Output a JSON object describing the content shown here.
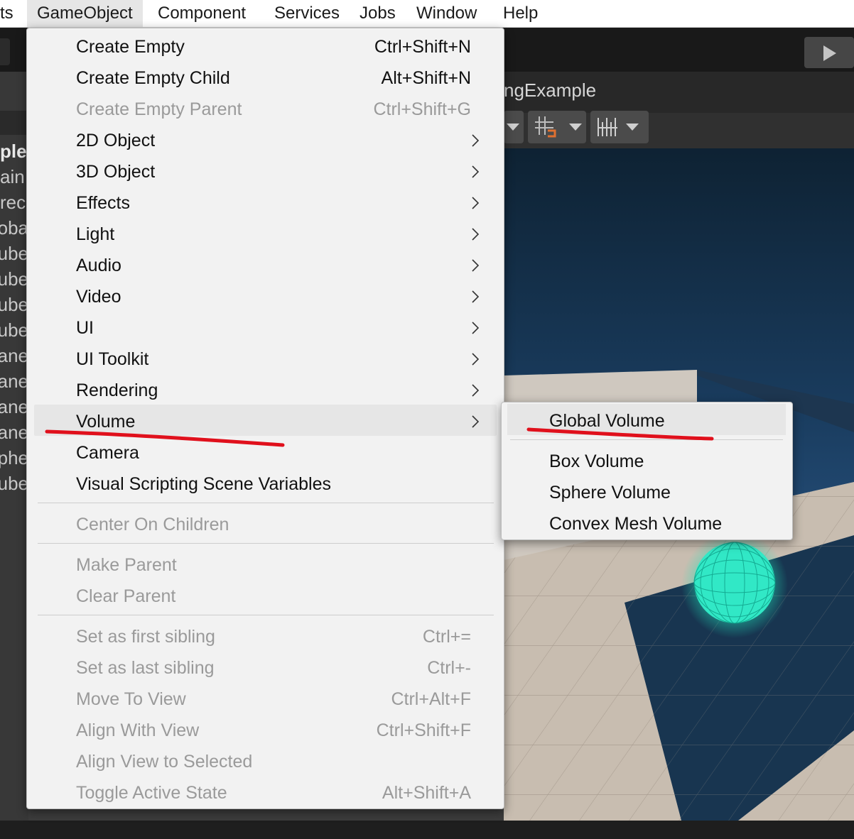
{
  "menubar": {
    "items": [
      "ts",
      "GameObject",
      "Component",
      "Services",
      "Jobs",
      "Window",
      "Help"
    ],
    "active": "GameObject"
  },
  "hierarchy": {
    "items": [
      "ple",
      "ain",
      "rec",
      "oba",
      "ube",
      "ube",
      "ube",
      "ube",
      "ane",
      "ane",
      "ane",
      "ane",
      "phe",
      "ube"
    ]
  },
  "scene": {
    "title": "ngExample"
  },
  "gameobject_menu": {
    "items": [
      {
        "label": "Create Empty",
        "shortcut": "Ctrl+Shift+N"
      },
      {
        "label": "Create Empty Child",
        "shortcut": "Alt+Shift+N"
      },
      {
        "label": "Create Empty Parent",
        "shortcut": "Ctrl+Shift+G"
      },
      {
        "label": "2D Object"
      },
      {
        "label": "3D Object"
      },
      {
        "label": "Effects"
      },
      {
        "label": "Light"
      },
      {
        "label": "Audio"
      },
      {
        "label": "Video"
      },
      {
        "label": "UI"
      },
      {
        "label": "UI Toolkit"
      },
      {
        "label": "Rendering"
      },
      {
        "label": "Volume"
      },
      {
        "label": "Camera"
      },
      {
        "label": "Visual Scripting Scene Variables"
      },
      {
        "label": "Center On Children"
      },
      {
        "label": "Make Parent"
      },
      {
        "label": "Clear Parent"
      },
      {
        "label": "Set as first sibling",
        "shortcut": "Ctrl+="
      },
      {
        "label": "Set as last sibling",
        "shortcut": "Ctrl+-"
      },
      {
        "label": "Move To View",
        "shortcut": "Ctrl+Alt+F"
      },
      {
        "label": "Align With View",
        "shortcut": "Ctrl+Shift+F"
      },
      {
        "label": "Align View to Selected"
      },
      {
        "label": "Toggle Active State",
        "shortcut": "Alt+Shift+A"
      }
    ]
  },
  "volume_submenu": {
    "items": [
      "Global Volume",
      "Box Volume",
      "Sphere Volume",
      "Convex Mesh Volume"
    ]
  },
  "colors": {
    "annotation": "#e0101c",
    "sphere": "#2ef0c8",
    "menu_bg": "#f2f2f2"
  }
}
